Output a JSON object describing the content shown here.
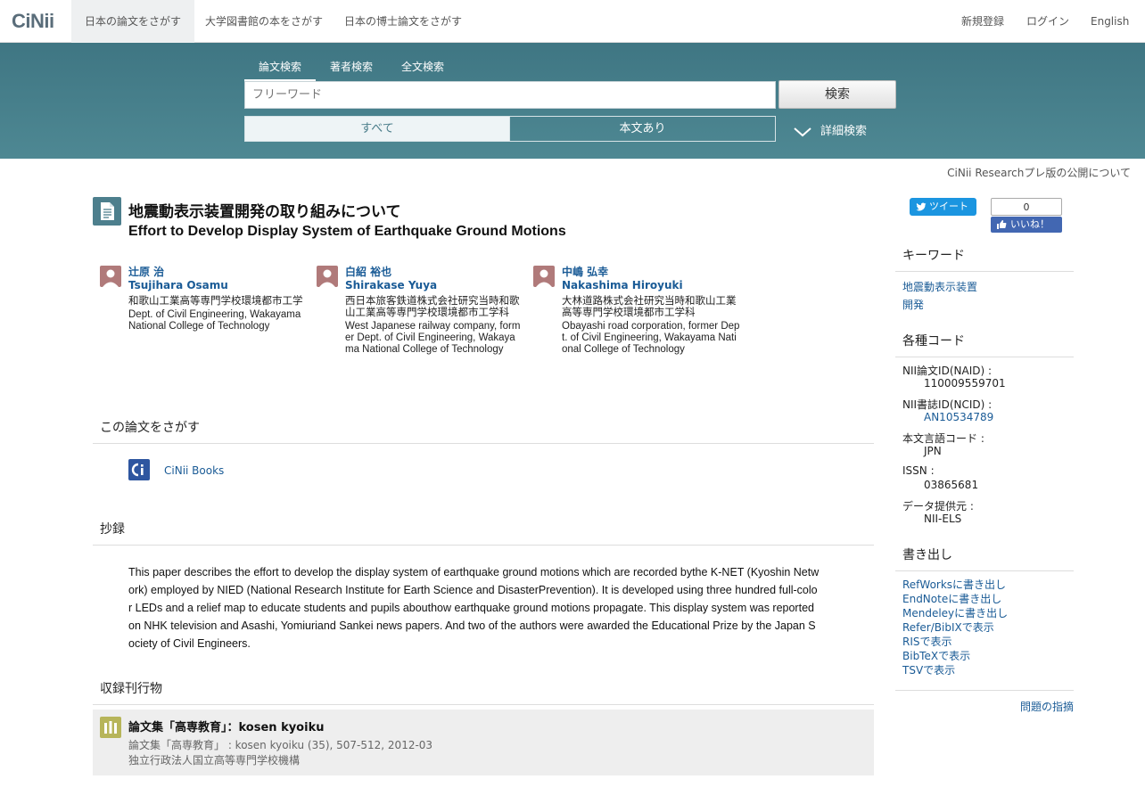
{
  "nav": {
    "logo": "CiNii",
    "tabs": [
      "日本の論文をさがす",
      "大学図書館の本をさがす",
      "日本の博士論文をさがす"
    ],
    "register": "新規登録",
    "login": "ログイン",
    "english": "English"
  },
  "search": {
    "tabs": [
      "論文検索",
      "著者検索",
      "全文検索"
    ],
    "placeholder": "フリーワード",
    "button": "検索",
    "filter_all": "すべて",
    "filter_fulltext": "本文あり",
    "advanced": "詳細検索"
  },
  "notice": "CiNii Researchプレ版の公開について",
  "article": {
    "title_ja": "地震動表示装置開発の取り組みについて",
    "title_en": "Effort to Develop Display System of Earthquake Ground Motions",
    "authors": [
      {
        "name_ja": "辻原 治",
        "name_en": "Tsujihara Osamu",
        "aff_ja": "和歌山工業高等専門学校環境都市工学",
        "aff_en": "Dept. of Civil Engineering, Wakayama National College of Technology"
      },
      {
        "name_ja": "白紹 裕也",
        "name_en": "Shirakase Yuya",
        "aff_ja": "西日本旅客鉄道株式会社研究当時和歌山工業高等専門学校環境都市工学科",
        "aff_en": "West Japanese railway company, former Dept. of Civil Engineering, Wakayama National College of Technology"
      },
      {
        "name_ja": "中嶋 弘幸",
        "name_en": "Nakashima Hiroyuki",
        "aff_ja": "大林道路株式会社研究当時和歌山工業高等専門学校環境都市工学科",
        "aff_en": "Obayashi road corporation, former Dept. of Civil Engineering, Wakayama National College of Technology"
      }
    ],
    "find_heading": "この論文をさがす",
    "cinii_books": "CiNii Books",
    "abstract_heading": "抄録",
    "abstract": "This paper describes the effort to develop the display system of earthquake ground motions which are recorded bythe K-NET (Kyoshin Network) employed by NIED (National Research Institute for Earth Science and DisasterPrevention). It is developed using three hundred full-color LEDs and a relief map to educate students and pupils abouthow earthquake ground motions propagate. This display system was reported on NHK television and Asashi, Yomiuriand Sankei news papers. And two of the authors were awarded the Educational Prize by the Japan Society of Civil Engineers.",
    "pub_heading": "収録刊行物",
    "pub_title": "論文集「高専教育」：kosen kyoiku",
    "pub_citation": "論文集「高専教育」 : kosen kyoiku (35), 507-512, 2012-03",
    "pub_publisher": "独立行政法人国立高等専門学校機構"
  },
  "sidebar": {
    "tweet": "ツイート",
    "like_count": "0",
    "like": "いいね！",
    "keywords_heading": "キーワード",
    "keywords": [
      "地震動表示装置",
      "開発"
    ],
    "codes_heading": "各種コード",
    "codes": [
      {
        "key": "NII論文ID(NAID) :",
        "value": "110009559701"
      },
      {
        "key": "NII書誌ID(NCID) :",
        "value": "AN10534789"
      },
      {
        "key": "本文言語コード :",
        "value": "JPN"
      },
      {
        "key": "ISSN :",
        "value": "03865681"
      },
      {
        "key": "データ提供元 :",
        "value": "NII-ELS"
      }
    ],
    "export_heading": "書き出し",
    "exports": [
      "RefWorksに書き出し",
      "EndNoteに書き出し",
      "Mendeleyに書き出し",
      "Refer/BibIXで表示",
      "RISで表示",
      "BibTeXで表示",
      "TSVで表示"
    ],
    "report": "問題の指摘"
  }
}
